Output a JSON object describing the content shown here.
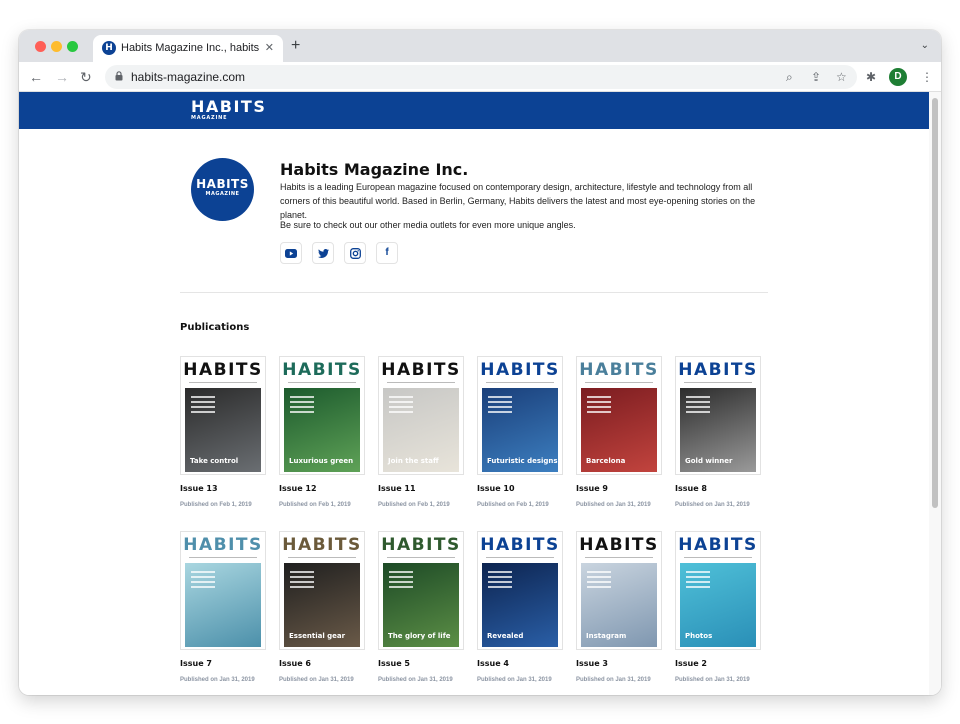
{
  "browser": {
    "tab_title": "Habits Magazine Inc., habits-m",
    "tab_favicon": "H",
    "url": "habits-magazine.com",
    "profile_initial": "D"
  },
  "site": {
    "logo_main": "HABITS",
    "logo_sub": "MAGAZINE"
  },
  "profile": {
    "name": "Habits Magazine Inc.",
    "description": "Habits is a leading European magazine focused on contemporary design, architecture, lifestyle and technology from all corners of this beautiful world. Based in Berlin, Germany, Habits delivers the latest and most eye-opening stories on the planet.",
    "cta": "Be sure to check out our other media outlets for even more unique angles.",
    "social_icons": [
      "youtube-icon",
      "twitter-icon",
      "instagram-icon",
      "facebook-icon"
    ]
  },
  "publications": {
    "heading": "Publications",
    "cover_masthead": "HABITS",
    "items": [
      {
        "issue": "Issue 13",
        "date": "Published on Feb 1, 2019",
        "caption": "Take control",
        "title_color": "#111111",
        "img_from": "#2b2b2b",
        "img_to": "#6a6e72"
      },
      {
        "issue": "Issue 12",
        "date": "Published on Feb 1, 2019",
        "caption": "Luxurious green",
        "title_color": "#1d6b5a",
        "img_from": "#1c5a2d",
        "img_to": "#5fa257"
      },
      {
        "issue": "Issue 11",
        "date": "Published on Feb 1, 2019",
        "caption": "Join the staff",
        "title_color": "#111111",
        "img_from": "#c7c7c5",
        "img_to": "#e8e4da"
      },
      {
        "issue": "Issue 10",
        "date": "Published on Feb 1, 2019",
        "caption": "Futuristic designs",
        "title_color": "#0c4294",
        "img_from": "#1a3f7a",
        "img_to": "#3d7fc0"
      },
      {
        "issue": "Issue 9",
        "date": "Published on Jan 31, 2019",
        "caption": "Barcelona",
        "title_color": "#4a7f9b",
        "img_from": "#7b1c20",
        "img_to": "#c2443e"
      },
      {
        "issue": "Issue 8",
        "date": "Published on Jan 31, 2019",
        "caption": "Gold winner",
        "title_color": "#0c4294",
        "img_from": "#2c2c2c",
        "img_to": "#9a9a9a"
      },
      {
        "issue": "Issue 7",
        "date": "Published on Jan 31, 2019",
        "caption": "",
        "title_color": "#4f8fab",
        "img_from": "#a9d6e0",
        "img_to": "#4c90aa"
      },
      {
        "issue": "Issue 6",
        "date": "Published on Jan 31, 2019",
        "caption": "Essential gear",
        "title_color": "#6b5a3a",
        "img_from": "#1f1f1f",
        "img_to": "#6a5a48"
      },
      {
        "issue": "Issue 5",
        "date": "Published on Jan 31, 2019",
        "caption": "The glory of life",
        "title_color": "#2f5a2e",
        "img_from": "#1d4a26",
        "img_to": "#5c8f46"
      },
      {
        "issue": "Issue 4",
        "date": "Published on Jan 31, 2019",
        "caption": "Revealed",
        "title_color": "#0c4294",
        "img_from": "#0d2450",
        "img_to": "#2a5fa7"
      },
      {
        "issue": "Issue 3",
        "date": "Published on Jan 31, 2019",
        "caption": "Instagram",
        "title_color": "#111111",
        "img_from": "#c9d4df",
        "img_to": "#7f97b0"
      },
      {
        "issue": "Issue 2",
        "date": "Published on Jan 31, 2019",
        "caption": "Photos",
        "title_color": "#0c4294",
        "img_from": "#4fc0d8",
        "img_to": "#2a8fb7"
      }
    ]
  }
}
